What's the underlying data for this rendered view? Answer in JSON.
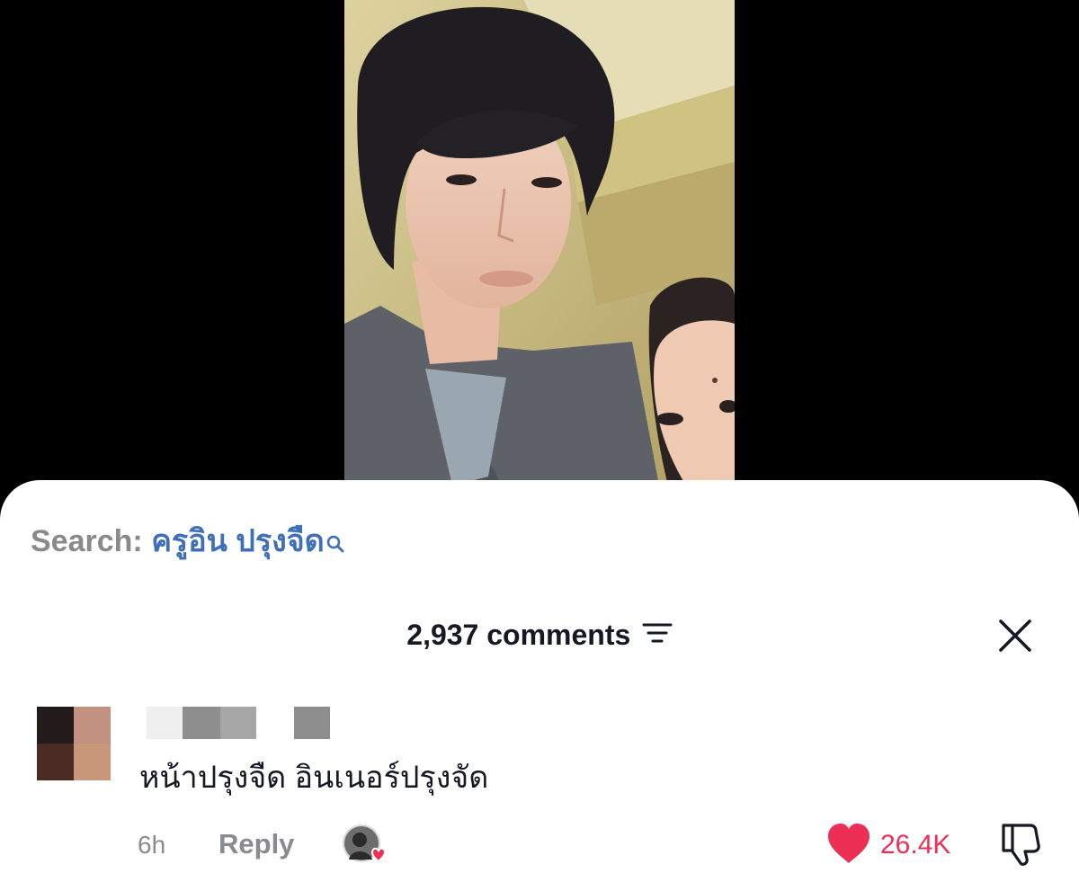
{
  "search": {
    "prefix": "Search:",
    "term": "ครูอิน ปรุงจืด"
  },
  "comments_header": {
    "count_label": "2,937 comments"
  },
  "comment": {
    "text": "หน้าปรุงจืด อินเนอร์ปรุงจัด",
    "time": "6h",
    "reply_label": "Reply",
    "like_count": "26.4K",
    "liked": true
  },
  "icons": {
    "search": "search-icon",
    "sort": "sort-icon",
    "close": "close-icon",
    "heart": "heart-icon",
    "dislike": "thumbs-down-icon",
    "creator_liked": "creator-liked-badge"
  },
  "colors": {
    "link_blue": "#3f6fb8",
    "like_red": "#ee2f55",
    "meta_gray": "#8a8b91",
    "text_dark": "#161823"
  }
}
